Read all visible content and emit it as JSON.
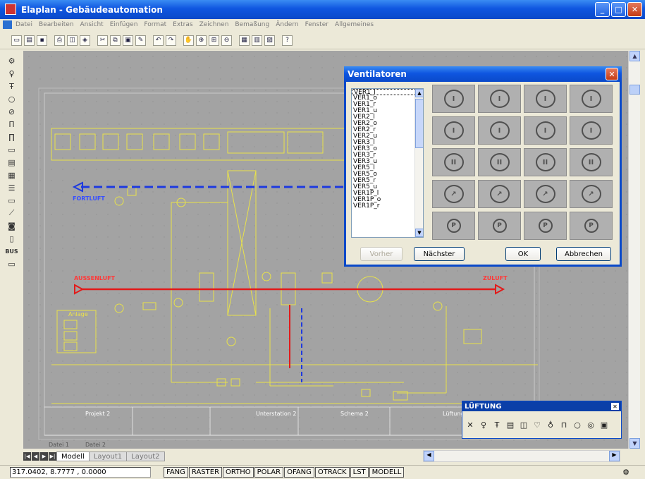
{
  "window": {
    "title": "Elaplan - Gebäudeautomation"
  },
  "menu": [
    "Datei",
    "Bearbeiten",
    "Ansicht",
    "Einfügen",
    "Format",
    "Extras",
    "Zeichnen",
    "Bemaßung",
    "Ändern",
    "Fenster",
    "Allgemeines"
  ],
  "toolbar_icons": [
    "new-icon",
    "open-icon",
    "save-icon",
    "print-icon",
    "preview-icon",
    "plot-icon",
    "cut-icon",
    "copy-icon",
    "paste-icon",
    "match-icon",
    "undo-icon",
    "redo-icon",
    "pan-icon",
    "zoom-realtime-icon",
    "zoom-window-icon",
    "zoom-previous-icon",
    "properties-icon",
    "designcenter-icon",
    "toolpalette-icon",
    "help-icon"
  ],
  "left_tools": [
    "fan-tool-1",
    "valve-tool",
    "sensor-tool",
    "circle-tool",
    "damper-tool",
    "filter-tool",
    "heater-tool",
    "panel-tool",
    "register-tool",
    "table-tool",
    "list-tool",
    "rect-tool",
    "diagonal-tool",
    "node-tool",
    "frame-tool"
  ],
  "left_tools_text": {
    "bus": "BUS"
  },
  "drawing": {
    "fortluft": "FORTLUFT",
    "aussenluft": "AUSSENLUFT",
    "zuluft": "ZULUFT",
    "anlage": "Anlage",
    "projekt": "Projekt 2",
    "unterstation": "Unterstation 2",
    "schema": "Schema 2",
    "lueftung": "Lüftung",
    "datei1": "Datei 1",
    "datei2": "Datei 2"
  },
  "dialog": {
    "title": "Ventilatoren",
    "list": [
      "VER1_l",
      "VER1_o",
      "VER1_r",
      "VER1_u",
      "VER2_l",
      "VER2_o",
      "VER2_r",
      "VER2_u",
      "VER3_l",
      "VER3_o",
      "VER3_r",
      "VER3_u",
      "VER5_l",
      "VER5_o",
      "VER5_r",
      "VER5_u",
      "VER1P_l",
      "VER1P_o",
      "VER1P_r"
    ],
    "tiles": [
      "I",
      "I",
      "I",
      "I",
      "I",
      "I",
      "I",
      "I",
      "II",
      "II",
      "II",
      "II",
      "↗",
      "↗",
      "↗",
      "↗",
      "P",
      "P",
      "P",
      "P"
    ],
    "btn_prev": "Vorher",
    "btn_next": "Nächster",
    "btn_ok": "OK",
    "btn_cancel": "Abbrechen"
  },
  "palette": {
    "title": "LÜFTUNG"
  },
  "tabs": {
    "model": "Modell",
    "layout1": "Layout1",
    "layout2": "Layout2"
  },
  "status": {
    "coords": "317.0402, 8.7777 , 0.0000",
    "buttons": [
      "FANG",
      "RASTER",
      "ORTHO",
      "POLAR",
      "OFANG",
      "OTRACK",
      "LST",
      "MODELL"
    ]
  }
}
